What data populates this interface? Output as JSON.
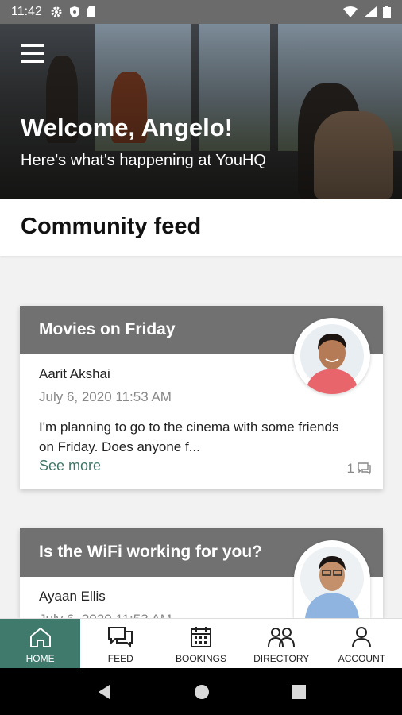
{
  "status_bar": {
    "time": "11:42",
    "left_icons": [
      "gear-icon",
      "shield-icon",
      "sd-card-icon"
    ],
    "right_icons": [
      "wifi-icon",
      "signal-icon",
      "battery-icon"
    ]
  },
  "hero": {
    "title": "Welcome, Angelo!",
    "subtitle": "Here's what's happening at YouHQ"
  },
  "feed": {
    "heading": "Community feed",
    "posts": [
      {
        "title": "Movies on Friday",
        "author": "Aarit Akshai",
        "date": "July 6, 2020 11:53 AM",
        "body": "I'm planning to go to the cinema with some friends on Friday. Does anyone f...",
        "see_more": "See more",
        "comment_count": "1"
      },
      {
        "title": "Is the WiFi working for you?",
        "author": "Ayaan Ellis",
        "date": "July 6, 2020 11:53 AM"
      }
    ]
  },
  "bottom_nav": {
    "items": [
      {
        "label": "HOME",
        "icon": "home-icon",
        "active": true
      },
      {
        "label": "FEED",
        "icon": "chat-icon",
        "active": false
      },
      {
        "label": "BOOKINGS",
        "icon": "calendar-icon",
        "active": false
      },
      {
        "label": "DIRECTORY",
        "icon": "people-icon",
        "active": false
      },
      {
        "label": "ACCOUNT",
        "icon": "person-icon",
        "active": false
      }
    ]
  },
  "colors": {
    "accent": "#3f7a6d",
    "card_header": "#717171",
    "link": "#3f7566"
  }
}
